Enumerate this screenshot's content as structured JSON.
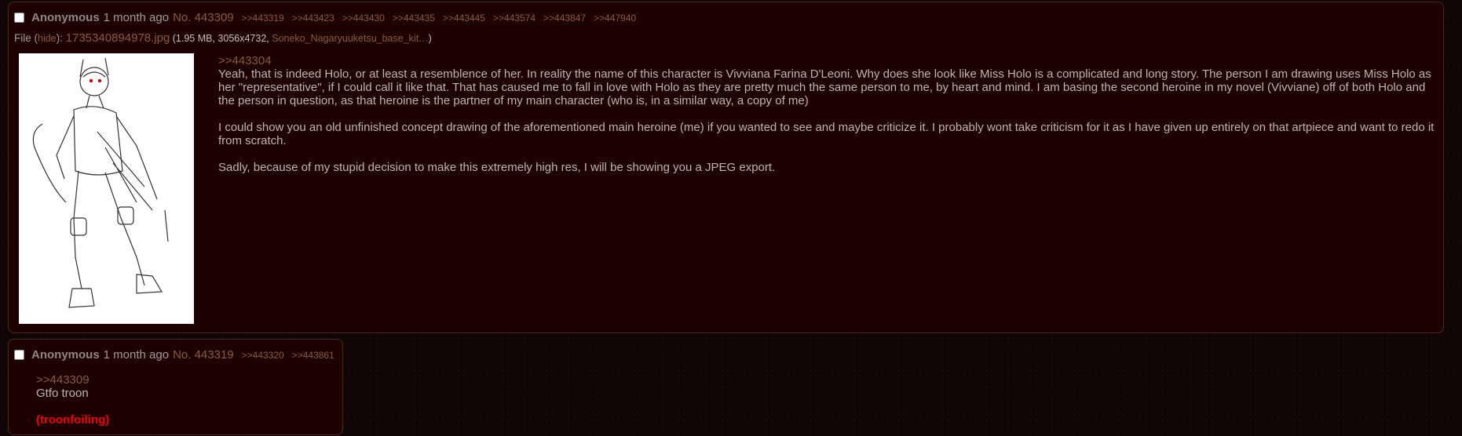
{
  "posts": [
    {
      "name": "Anonymous",
      "date": "1 month ago",
      "post_number": "No. 443309",
      "backlinks": [
        ">>443319",
        ">>443423",
        ">>443430",
        ">>443435",
        ">>443445",
        ">>443574",
        ">>443847",
        ">>447940"
      ],
      "file": {
        "label": "File (",
        "hide": "hide",
        "after_hide": "): ",
        "filename": "1735340894978.jpg",
        "info_open": " (1.95 MB, 3056x4732, ",
        "original_name": "Soneko_Nagaryuuketsu_base_kit…",
        "info_close": ")"
      },
      "quote": ">>443304",
      "paragraphs": [
        "Yeah, that is indeed Holo, or at least a resemblence of her. In reality the name of this character is Vivviana Farina D'Leoni. Why does she look like Miss Holo is a complicated and long story. The person I am drawing uses Miss Holo as her \"representative\", if I could call it like that. That has caused me to fall in love with Holo as they are pretty much the same person to me, by heart and mind. I am basing the second heroine in my novel (Vivviane) off of both Holo and the person in question, as that heroine is the partner of my main character (who is, in a similar way, a copy of me)",
        "I could show you an old unfinished concept drawing of the aforementioned main heroine (me) if you wanted to see and maybe criticize it. I probably wont take criticism for it as I have given up entirely on that artpiece and want to redo it from scratch.",
        "Sadly, because of my stupid decision to make this extremely high res, I will be showing you a JPEG export."
      ]
    },
    {
      "name": "Anonymous",
      "date": "1 month ago",
      "post_number": "No. 443319",
      "backlinks": [
        ">>443320",
        ">>443861"
      ],
      "quote": ">>443309",
      "text": "Gtfo troon",
      "redtext": "(troonfoiling)"
    }
  ]
}
